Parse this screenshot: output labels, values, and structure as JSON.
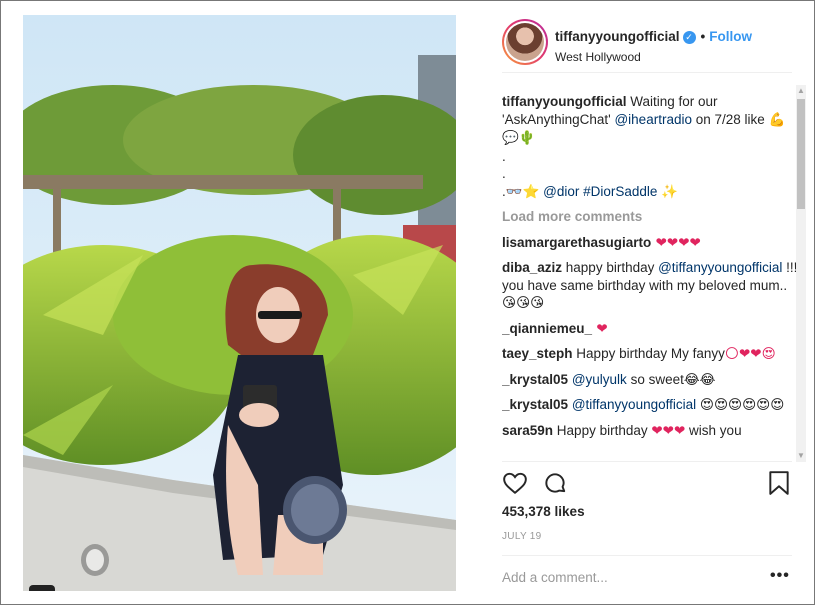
{
  "post": {
    "header": {
      "username": "tiffanyyoungofficial",
      "verified_mark": "✓",
      "separator": "•",
      "follow_label": "Follow",
      "location": "West Hollywood"
    },
    "caption": {
      "username": "tiffanyyoungofficial",
      "text_1": " Waiting for our 'AskAnythingChat' ",
      "mention": "@iheartradio",
      "text_2": " on 7/28 like ",
      "emoji_1": "💪💬🌵",
      "dot_1": ".",
      "dot_2": ".",
      "dot_3": ".",
      "emoji_2": "👓⭐",
      "mention_2": "@dior",
      "hashtag": "#DiorSaddle",
      "emoji_3": "✨"
    },
    "load_more_label": "Load more comments",
    "comments": [
      {
        "username": "lisamargarethasugiarto",
        "text": "",
        "emoji": " ❤❤❤❤"
      },
      {
        "username": "diba_aziz",
        "text": " happy birthday ",
        "mention": "@tiffanyyoungofficial",
        "text_2": " !!! you have same birthday with my beloved mum..",
        "emoji": "😘😘😘"
      },
      {
        "username": "_qianniemeu_",
        "text": "",
        "emoji": " ❤"
      },
      {
        "username": "taey_steph",
        "text": " Happy birthday My fanyy",
        "emoji": "🌕❤❤😍"
      },
      {
        "username": "_krystal05",
        "text": " ",
        "mention": "@yulyulk",
        "text_2": " so sweet",
        "emoji": "😂😂"
      },
      {
        "username": "_krystal05",
        "text": " ",
        "mention": "@tiffanyyoungofficial",
        "text_2": " ",
        "emoji": "😍😍😍😍😍😍"
      },
      {
        "username": "sara59n",
        "text": " Happy birthday ",
        "emoji": "❤❤❤",
        "text_2": " wish you"
      }
    ],
    "actions": {
      "like_icon": "heart-outline-icon",
      "comment_icon": "comment-bubble-icon",
      "save_icon": "bookmark-icon"
    },
    "likes_count": "453,378 likes",
    "date": "JULY 19",
    "add_comment_placeholder": "Add a comment...",
    "more_options_label": "•••"
  },
  "colors": {
    "accent": "#3897f0",
    "text": "#262626",
    "muted": "#999999",
    "link": "#003569",
    "heart": "#e0245e"
  }
}
